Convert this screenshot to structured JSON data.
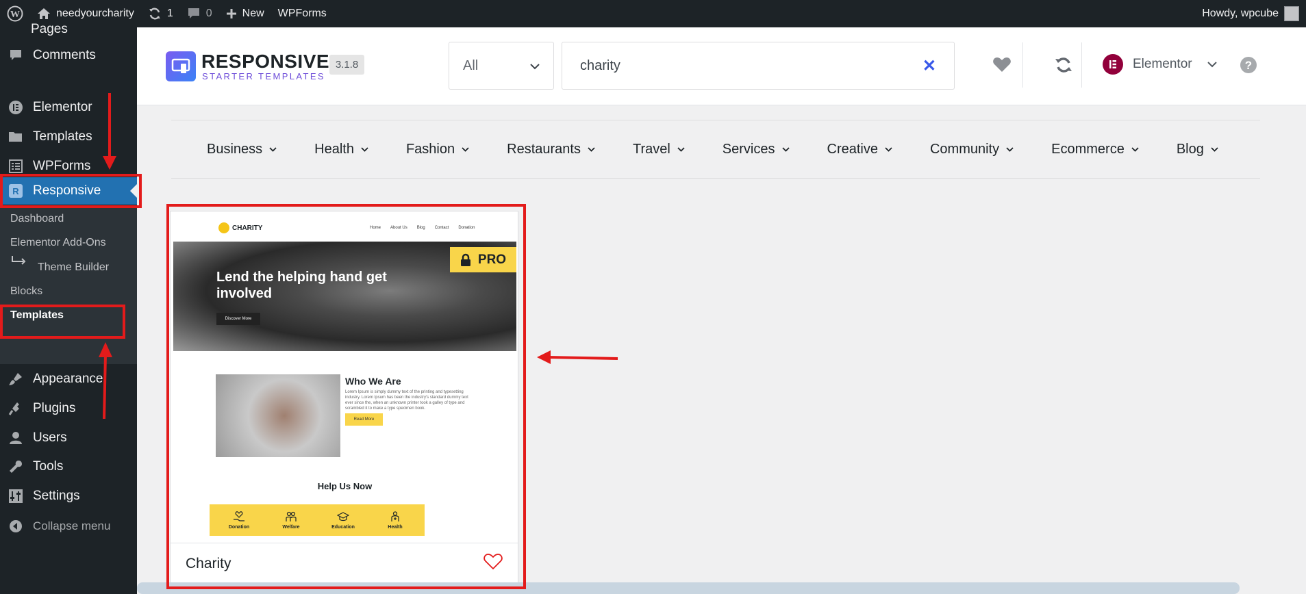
{
  "adminbar": {
    "site_name": "needyourcharity",
    "updates_count": "1",
    "comments_count": "0",
    "new_label": "New",
    "wpforms_label": "WPForms",
    "howdy": "Howdy, wpcube"
  },
  "sidebar": {
    "partial_label": "Pages",
    "items": [
      {
        "label": "Comments",
        "icon": "comment-icon"
      },
      {
        "label": "Elementor",
        "icon": "elementor-icon"
      },
      {
        "label": "Templates",
        "icon": "folder-icon"
      },
      {
        "label": "WPForms",
        "icon": "forms-icon"
      },
      {
        "label": "Responsive",
        "icon": "responsive-icon"
      },
      {
        "label": "Appearance",
        "icon": "brush-icon"
      },
      {
        "label": "Plugins",
        "icon": "plugin-icon"
      },
      {
        "label": "Users",
        "icon": "user-icon"
      },
      {
        "label": "Tools",
        "icon": "wrench-icon"
      },
      {
        "label": "Settings",
        "icon": "settings-icon"
      },
      {
        "label": "Collapse menu",
        "icon": "collapse-icon"
      }
    ],
    "submenu": [
      {
        "label": "Dashboard"
      },
      {
        "label": "Elementor Add-Ons"
      },
      {
        "label": "Theme Builder"
      },
      {
        "label": "Blocks"
      },
      {
        "label": "Templates"
      }
    ]
  },
  "header": {
    "logo_title": "RESPONSIVE",
    "logo_subtitle": "STARTER TEMPLATES",
    "version": "3.1.8",
    "filter_value": "All",
    "search_value": "charity",
    "builder": "Elementor"
  },
  "categories": [
    "Business",
    "Health",
    "Fashion",
    "Restaurants",
    "Travel",
    "Services",
    "Creative",
    "Community",
    "Ecommerce",
    "Blog"
  ],
  "card": {
    "title": "Charity",
    "badge": "PRO",
    "preview": {
      "logo": "CHARITY",
      "nav": [
        "Home",
        "About Us",
        "Blog",
        "Contact",
        "Donation"
      ],
      "hero_title": "Lend the helping hand get involved",
      "hero_button": "Discover More",
      "who_title": "Who We Are",
      "who_text": "Lorem Ipsum is simply dummy text of the printing and typesetting industry. Lorem Ipsum has been the industry's standard dummy text ever since the, when an unknown printer took a galley of type and scrambled it to make a type specimen book.",
      "who_button": "Read More",
      "help_title": "Help Us Now",
      "tiles": [
        "Donation",
        "Welfare",
        "Education",
        "Health"
      ]
    }
  },
  "colors": {
    "admin_dark": "#1d2327",
    "active_blue": "#2271b1",
    "annotation_red": "#e31b1b",
    "accent_yellow": "#f9d54a"
  }
}
